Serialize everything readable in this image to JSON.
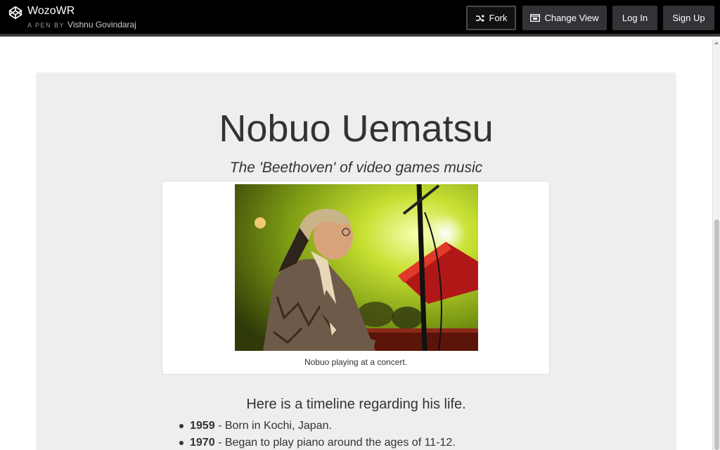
{
  "header": {
    "pen_title": "WozoWR",
    "pen_by_label": "A PEN BY",
    "author": "Vishnu Govindaraj",
    "buttons": {
      "fork": "Fork",
      "change_view": "Change View",
      "login": "Log In",
      "signup": "Sign Up"
    }
  },
  "main": {
    "title": "Nobuo Uematsu",
    "subtitle": "The 'Beethoven' of video games music",
    "image": {
      "caption": "Nobuo playing at a concert."
    },
    "timeline_heading": "Here is a timeline regarding his life.",
    "timeline": [
      {
        "year": "1959",
        "text": " - Born in Kochi, Japan."
      },
      {
        "year": "1970",
        "text": " - Began to play piano around the ages of 11-12."
      }
    ]
  },
  "colors": {
    "topbar": "#000000",
    "button": "#333337",
    "panel": "#eeeeee",
    "text": "#333333"
  }
}
